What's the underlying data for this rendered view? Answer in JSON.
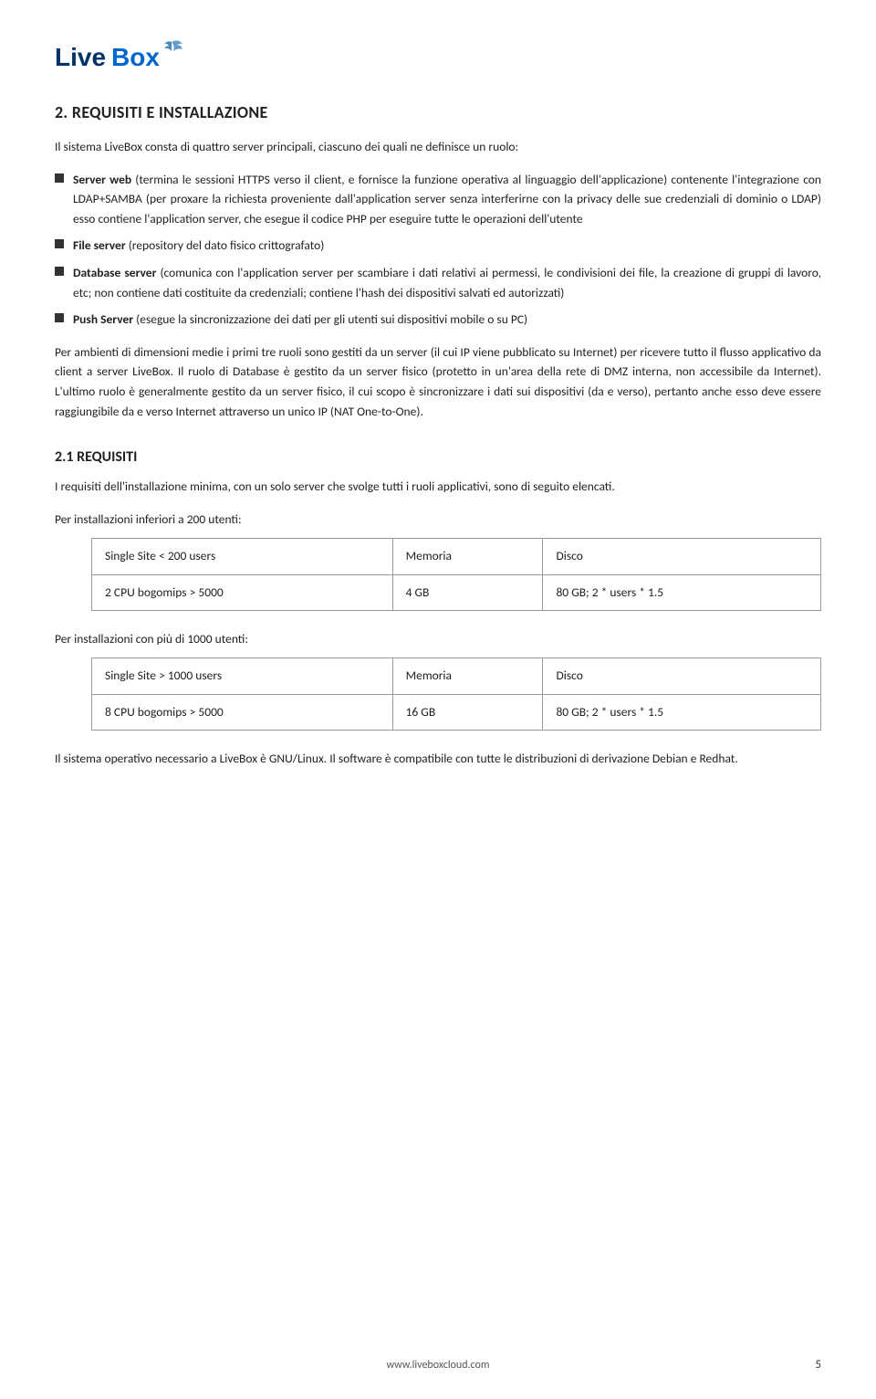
{
  "logo": {
    "text_live": "Live",
    "text_box": "Box",
    "bird_symbol": "🐦"
  },
  "section2": {
    "heading": "2.  REQUISITI E INSTALLAZIONE",
    "intro": "Il sistema LiveBox consta di quattro server principali, ciascuno dei quali ne definisce un ruolo:",
    "bullets": [
      {
        "term": "Server web",
        "term_style": "bold",
        "text": " (termina le sessioni HTTPS verso il client, e fornisce la funzione operativa al linguaggio dell'applicazione) contenente l'integrazione con LDAP+SAMBA (per proxare la richiesta proveniente dall'application server senza interferirne con la privacy delle sue credenziali di dominio o LDAP) esso contiene l'application server, che esegue il codice PHP per eseguire tutte le operazioni dell'utente"
      },
      {
        "term": "File server",
        "term_style": "bold",
        "text": " (repository del dato fisico crittografato)"
      },
      {
        "term": "Database server",
        "term_style": "bold",
        "text": " (comunica con l'application server per scambiare i dati relativi ai permessi, le condivisioni dei file, la creazione di gruppi di lavoro, etc; non contiene dati costituite da credenziali; contiene l'hash dei dispositivi salvati ed autorizzati)"
      },
      {
        "term": "Push Server",
        "term_style": "bold",
        "text": " (esegue la sincronizzazione dei dati per gli utenti sui dispositivi mobile o su PC)"
      }
    ],
    "para1": "Per ambienti di dimensioni medie i primi tre ruoli sono gestiti da un server (il cui IP viene pubblicato su Internet) per ricevere tutto il flusso applicativo da client a server LiveBox. Il ruolo di Database è gestito da un server fisico (protetto in un'area della rete di DMZ interna, non accessibile da Internet). L'ultimo ruolo è generalmente gestito da un server fisico, il cui scopo è sincronizzare i dati sui dispositivi (da e verso), pertanto anche esso deve essere raggiungibile da e verso Internet attraverso un unico IP (NAT One-to-One).",
    "subsection": {
      "heading": "2.1 REQUISITI",
      "intro": "I requisiti dell'installazione minima, con un solo server che svolge tutti i ruoli applicativi, sono di seguito elencati.",
      "table1_label": "Per installazioni inferiori a 200 utenti:",
      "table1": {
        "rows": [
          [
            "Single Site < 200 users",
            "Memoria",
            "Disco"
          ],
          [
            "2 CPU bogomips > 5000",
            "4 GB",
            "80 GB; 2 * users * 1.5"
          ]
        ]
      },
      "table2_label": "Per installazioni con più di 1000 utenti:",
      "table2": {
        "rows": [
          [
            "Single Site > 1000 users",
            "Memoria",
            "Disco"
          ],
          [
            "8 CPU bogomips > 5000",
            "16 GB",
            "80 GB; 2 * users * 1.5"
          ]
        ]
      },
      "closing": "Il sistema operativo necessario a LiveBox è GNU/Linux. Il software è compatibile con tutte le distribuzioni di derivazione Debian e Redhat."
    }
  },
  "footer": {
    "url": "www.liveboxcloud.com",
    "page": "5"
  }
}
